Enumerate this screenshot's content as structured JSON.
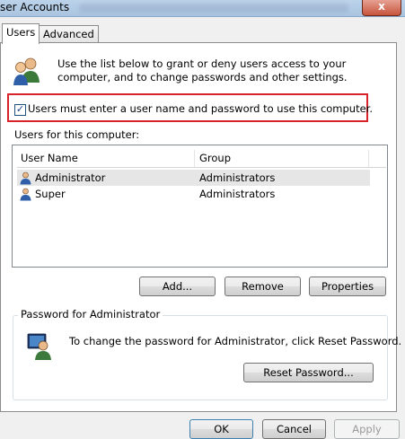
{
  "window": {
    "title": "ser Accounts",
    "close_glyph": "x"
  },
  "tabs": [
    {
      "label": "Users",
      "active": true
    },
    {
      "label": "Advanced",
      "active": false
    }
  ],
  "users_tab": {
    "description": "Use the list below to grant or deny users access to your computer, and to change passwords and other settings.",
    "require_login_checkbox": {
      "label": "Users must enter a user name and password to use this computer.",
      "checked": true,
      "highlight_color": "#d8232a"
    },
    "list_label": "Users for this computer:",
    "columns": [
      "User Name",
      "Group"
    ],
    "rows": [
      {
        "name": "Administrator",
        "group": "Administrators",
        "selected": true,
        "icon": "user-icon"
      },
      {
        "name": "Super",
        "group": "Administrators",
        "selected": false,
        "icon": "user-icon"
      }
    ],
    "buttons": {
      "add": "Add...",
      "remove": "Remove",
      "properties": "Properties"
    },
    "password_group": {
      "title": "Password for Administrator",
      "text": "To change the password for Administrator, click Reset Password.",
      "reset_button": "Reset Password..."
    }
  },
  "dialog_buttons": {
    "ok": "OK",
    "cancel": "Cancel",
    "apply": "Apply",
    "apply_enabled": false
  }
}
